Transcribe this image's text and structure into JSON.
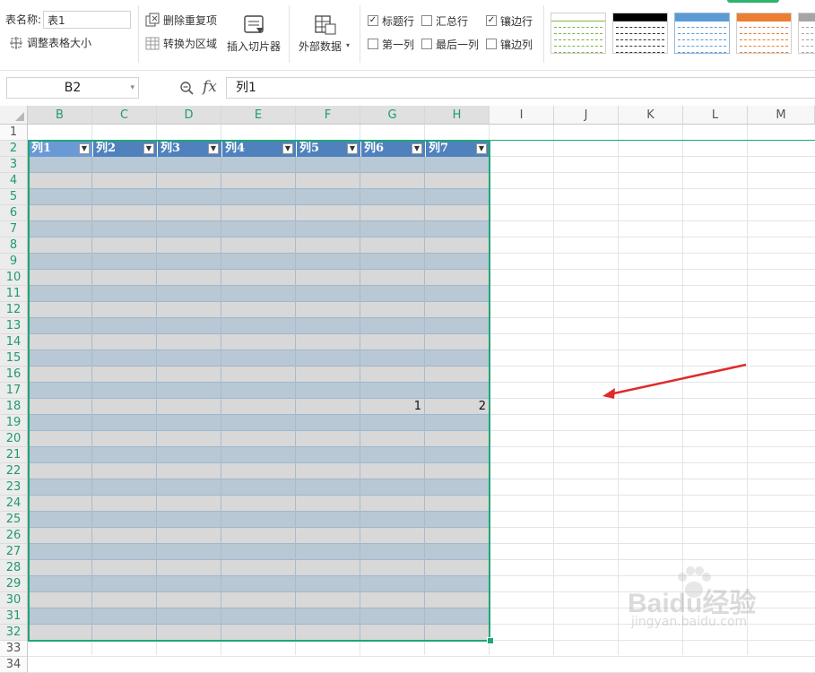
{
  "ribbon": {
    "table_name_label": "表名称:",
    "table_name_value": "表1",
    "resize_table": "调整表格大小",
    "remove_duplicates": "删除重复项",
    "convert_to_range": "转换为区域",
    "insert_slicer": "插入切片器",
    "external_data": "外部数据",
    "options": [
      {
        "label": "标题行",
        "checked": true
      },
      {
        "label": "汇总行",
        "checked": false
      },
      {
        "label": "镶边行",
        "checked": true
      },
      {
        "label": "第一列",
        "checked": false
      },
      {
        "label": "最后一列",
        "checked": false
      },
      {
        "label": "镶边列",
        "checked": false
      }
    ],
    "styles": [
      {
        "header": "#ffffff",
        "line": "#7ab648"
      },
      {
        "header": "#000000",
        "line": "#333333"
      },
      {
        "header": "#5b9bd5",
        "line": "#5b9bd5"
      },
      {
        "header": "#ed7d31",
        "line": "#ed7d31"
      },
      {
        "header": "#a5a5a5",
        "line": "#a5a5a5"
      }
    ]
  },
  "formula_bar": {
    "cell_ref": "B2",
    "fx_symbol": "fx",
    "value": "列1"
  },
  "columns": [
    "B",
    "C",
    "D",
    "E",
    "F",
    "G",
    "H",
    "I",
    "J",
    "K",
    "L",
    "M"
  ],
  "rows": [
    "1",
    "2",
    "3",
    "4",
    "5",
    "6",
    "7",
    "8",
    "9",
    "10",
    "11",
    "12",
    "13",
    "14",
    "15",
    "16",
    "17",
    "18",
    "19",
    "20",
    "21",
    "22",
    "23",
    "24",
    "25",
    "26",
    "27",
    "28",
    "29",
    "30",
    "31",
    "32",
    "33",
    "34"
  ],
  "table": {
    "headers": [
      "列1",
      "列2",
      "列3",
      "列4",
      "列5",
      "列6",
      "列7"
    ],
    "cells": [
      {
        "row": "18",
        "col": "G",
        "value": "1"
      },
      {
        "row": "18",
        "col": "H",
        "value": "2"
      }
    ],
    "banded_colors": [
      "#d8d8d8",
      "#b8c8d4"
    ],
    "header_color": "#4f81bd",
    "border_color": "#21a675"
  },
  "watermark": {
    "brand": "Baidu经验",
    "url": "jingyan.baidu.com"
  }
}
